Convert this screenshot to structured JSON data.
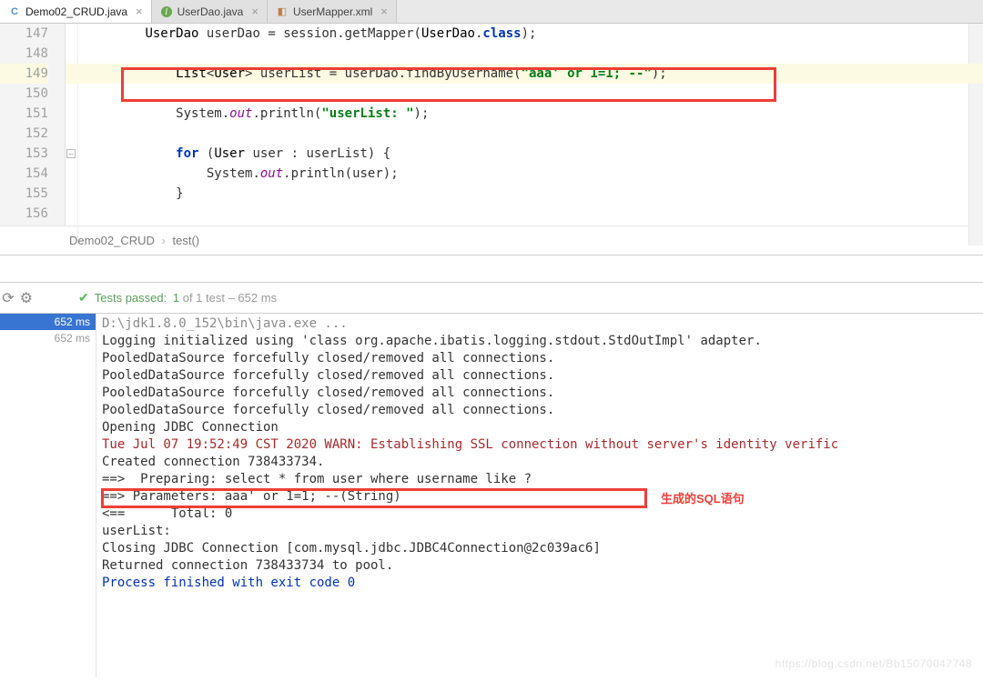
{
  "tabs": [
    {
      "label": "Demo02_CRUD.java",
      "icon": "C",
      "active": true
    },
    {
      "label": "UserDao.java",
      "icon": "I",
      "active": false
    },
    {
      "label": "UserMapper.xml",
      "icon": "X",
      "active": false
    }
  ],
  "gutter": [
    "147",
    "148",
    "149",
    "150",
    "151",
    "152",
    "153",
    "154",
    "155",
    "156"
  ],
  "code": {
    "l147": {
      "pre": "        ",
      "type1": "UserDao",
      "sp1": " ",
      "id1": "userDao",
      "eq": " = ",
      "id2": "session",
      "dot": ".",
      "m": "getMapper",
      "op": "(",
      "type2": "UserDao",
      "dotc": ".",
      "kw": "class",
      "cl": ");"
    },
    "l149": {
      "pre": "            ",
      "type": "List",
      "ang": "<",
      "arg": "User",
      "ange": ">",
      "sp": " ",
      "id": "userList",
      "eq": " = ",
      "rhs": "userDao",
      "dot": ".",
      "m": "findByUsername",
      "op": "(",
      "str": "\"aaa' or 1=1; --\"",
      "cl": ");"
    },
    "l151": {
      "pre": "            ",
      "qual": "System",
      "d1": ".",
      "stat": "out",
      "d2": ".",
      "m": "println",
      "op": "(",
      "str": "\"userList: \"",
      "cl": ");"
    },
    "l153": {
      "pre": "            ",
      "kw": "for",
      "sp": " (",
      "type": "User",
      "s2": " ",
      "id": "user",
      "co": " : ",
      "it": "userList",
      "end": ") {"
    },
    "l154": {
      "pre": "                ",
      "qual": "System",
      "d1": ".",
      "stat": "out",
      "d2": ".",
      "m": "println",
      "op": "(",
      "arg": "user",
      "cl": ");"
    },
    "l155": {
      "pre": "            ",
      "br": "}"
    }
  },
  "breadcrumb": {
    "parent": "Demo02_CRUD",
    "child": "test()"
  },
  "toolbar": {
    "tests_passed_prefix": "Tests passed:",
    "tests_passed_count": "1",
    "tests_passed_of": " of 1 test",
    "tests_passed_time": " – 652 ms"
  },
  "tree": {
    "sel": "652 ms",
    "next": "652 ms"
  },
  "console": {
    "lines": [
      {
        "cls": "con-grey",
        "text": "D:\\jdk1.8.0_152\\bin\\java.exe ..."
      },
      {
        "cls": "",
        "text": "Logging initialized using 'class org.apache.ibatis.logging.stdout.StdOutImpl' adapter."
      },
      {
        "cls": "",
        "text": "PooledDataSource forcefully closed/removed all connections."
      },
      {
        "cls": "",
        "text": "PooledDataSource forcefully closed/removed all connections."
      },
      {
        "cls": "",
        "text": "PooledDataSource forcefully closed/removed all connections."
      },
      {
        "cls": "",
        "text": "PooledDataSource forcefully closed/removed all connections."
      },
      {
        "cls": "",
        "text": "Opening JDBC Connection"
      },
      {
        "cls": "con-warn",
        "text": "Tue Jul 07 19:52:49 CST 2020 WARN: Establishing SSL connection without server's identity verific"
      },
      {
        "cls": "",
        "text": "Created connection 738433734."
      },
      {
        "cls": "",
        "text": "==>  Preparing: select * from user where username like ? "
      },
      {
        "cls": "",
        "text": "==> Parameters: aaa' or 1=1; --(String)"
      },
      {
        "cls": "",
        "text": "<==      Total: 0"
      },
      {
        "cls": "",
        "text": "userList: "
      },
      {
        "cls": "",
        "text": "Closing JDBC Connection [com.mysql.jdbc.JDBC4Connection@2c039ac6]"
      },
      {
        "cls": "",
        "text": "Returned connection 738433734 to pool."
      },
      {
        "cls": "",
        "text": ""
      },
      {
        "cls": "con-blue",
        "text": "Process finished with exit code 0"
      }
    ]
  },
  "annotation_sql": "生成的SQL语句",
  "watermark": "https://blog.csdn.net/Bb15070047748"
}
